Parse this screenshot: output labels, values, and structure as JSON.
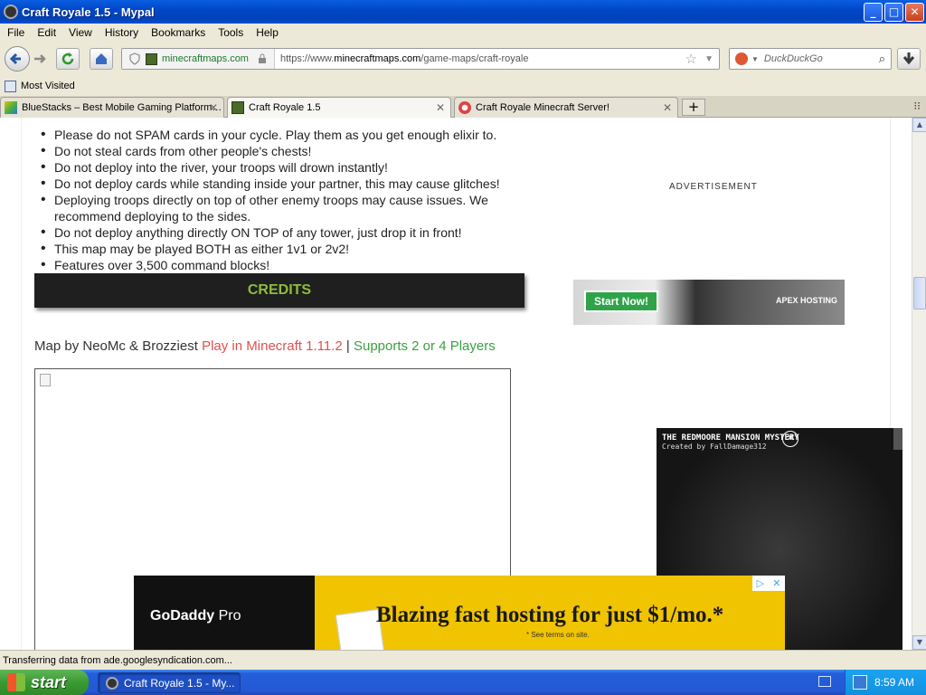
{
  "window": {
    "title": "Craft Royale 1.5 - Mypal",
    "buttons": {
      "minimize": "_",
      "maximize": "□",
      "close": "✕"
    }
  },
  "menubar": {
    "items": [
      "File",
      "Edit",
      "View",
      "History",
      "Bookmarks",
      "Tools",
      "Help"
    ]
  },
  "navbar": {
    "site": "minecraftmaps.com",
    "url_prefix": "https://www.",
    "url_domain": "minecraftmaps.com",
    "url_path": "/game-maps/craft-royale",
    "search_placeholder": "DuckDuckGo"
  },
  "bookmarks": {
    "most_visited": "Most Visited"
  },
  "tabs": [
    {
      "label": "BlueStacks – Best Mobile Gaming Platform…",
      "active": false
    },
    {
      "label": "Craft Royale 1.5",
      "active": true
    },
    {
      "label": "Craft Royale Minecraft Server!",
      "active": false
    }
  ],
  "new_tab_label": "+",
  "content": {
    "rules": [
      "Please do not SPAM cards in your cycle. Play them as you get enough elixir to.",
      "Do not steal cards from other people's chests!",
      "Do not deploy into the river, your troops will drown instantly!",
      "Do not deploy cards while standing inside your partner, this may cause glitches!",
      "Deploying troops directly on top of other enemy troops may cause issues. We recommend deploying to the sides.",
      "Do not deploy anything directly ON TOP of any tower, just drop it in front!",
      "This map may be played BOTH as either 1v1 or 2v2!",
      "Features over 3,500 command blocks!"
    ],
    "credits_heading": "CREDITS",
    "map_by": "Map by NeoMc & Brozziest",
    "play_in": "Play in Minecraft 1.11.2",
    "separator": "|",
    "supports": "Supports 2 or 4 Players"
  },
  "sidebar": {
    "ad_label": "ADVERTISEMENT",
    "apex_button": "Start Now!",
    "apex_brand": "APEX HOSTING",
    "video_title": "THE REDMOORE MANSION MYSTERY",
    "video_sub": "Created by FallDamage312"
  },
  "bottom_ad": {
    "brand": "GoDaddy",
    "brand_suffix": "Pro",
    "headline": "Blazing fast hosting for just $1/mo.*",
    "note": "* See terms on site."
  },
  "statusbar": {
    "text": "Transferring data from ade.googlesyndication.com..."
  },
  "taskbar": {
    "start": "start",
    "item": "Craft Royale 1.5 - My...",
    "clock": "8:59 AM"
  }
}
